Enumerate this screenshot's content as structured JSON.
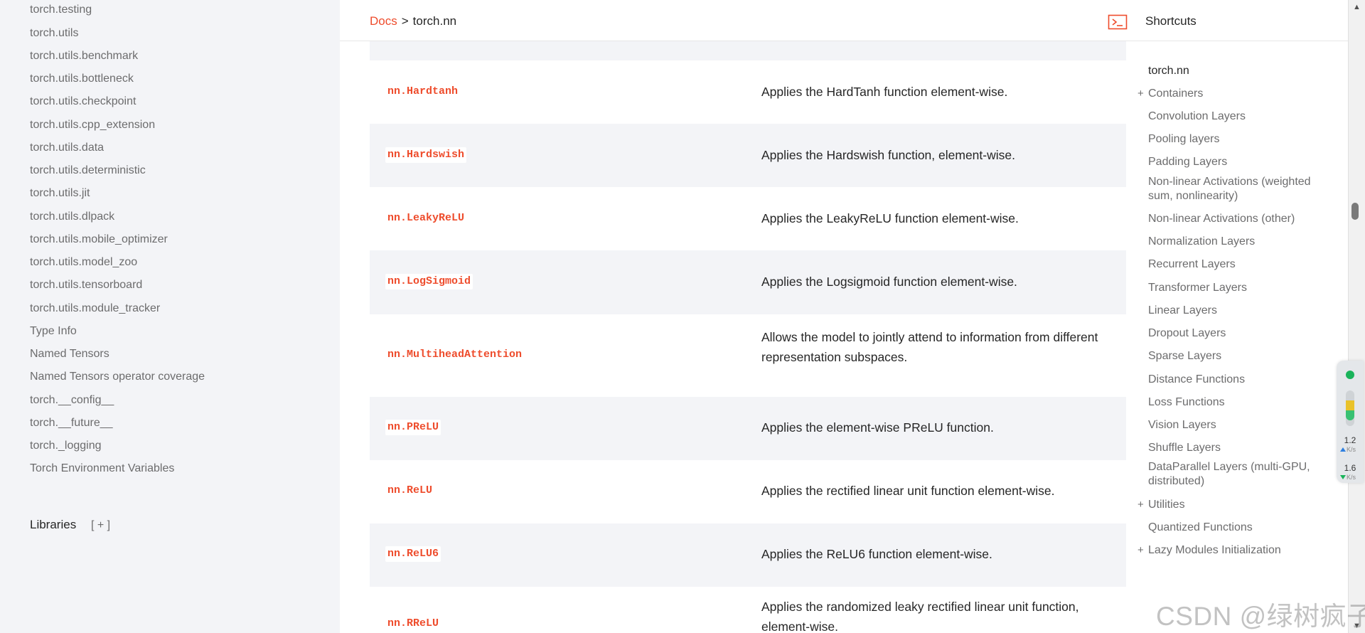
{
  "sidebar": {
    "items": [
      {
        "label": "torch.testing"
      },
      {
        "label": "torch.utils"
      },
      {
        "label": "torch.utils.benchmark"
      },
      {
        "label": "torch.utils.bottleneck"
      },
      {
        "label": "torch.utils.checkpoint"
      },
      {
        "label": "torch.utils.cpp_extension"
      },
      {
        "label": "torch.utils.data"
      },
      {
        "label": "torch.utils.deterministic"
      },
      {
        "label": "torch.utils.jit"
      },
      {
        "label": "torch.utils.dlpack"
      },
      {
        "label": "torch.utils.mobile_optimizer"
      },
      {
        "label": "torch.utils.model_zoo"
      },
      {
        "label": "torch.utils.tensorboard"
      },
      {
        "label": "torch.utils.module_tracker"
      },
      {
        "label": "Type Info"
      },
      {
        "label": "Named Tensors"
      },
      {
        "label": "Named Tensors operator coverage"
      },
      {
        "label": "torch.__config__"
      },
      {
        "label": "torch.__future__"
      },
      {
        "label": "torch._logging"
      },
      {
        "label": "Torch Environment Variables"
      }
    ],
    "libraries": {
      "label": "Libraries",
      "toggle": "[ + ]"
    }
  },
  "header": {
    "breadcrumb": {
      "root": "Docs",
      "separator": ">",
      "current": "torch.nn"
    },
    "terminal_icon": "terminal-icon",
    "shortcuts_title": "Shortcuts"
  },
  "table": {
    "rows": [
      {
        "name": "",
        "desc": ""
      },
      {
        "name": "nn.Hardtanh",
        "desc": "Applies the HardTanh function element-wise."
      },
      {
        "name": "nn.Hardswish",
        "desc": "Applies the Hardswish function, element-wise."
      },
      {
        "name": "nn.LeakyReLU",
        "desc": "Applies the LeakyReLU function element-wise."
      },
      {
        "name": "nn.LogSigmoid",
        "desc": "Applies the Logsigmoid function element-wise."
      },
      {
        "name": "nn.MultiheadAttention",
        "desc": "Allows the model to jointly attend to information from different representation subspaces."
      },
      {
        "name": "nn.PReLU",
        "desc": "Applies the element-wise PReLU function."
      },
      {
        "name": "nn.ReLU",
        "desc": "Applies the rectified linear unit function element-wise."
      },
      {
        "name": "nn.ReLU6",
        "desc": "Applies the ReLU6 function element-wise."
      },
      {
        "name": "nn.RReLU",
        "desc": "Applies the randomized leaky rectified linear unit function, element-wise."
      }
    ]
  },
  "toc": {
    "items": [
      {
        "label": "torch.nn",
        "plus": ""
      },
      {
        "label": "Containers",
        "plus": "+"
      },
      {
        "label": "Convolution Layers",
        "plus": ""
      },
      {
        "label": "Pooling layers",
        "plus": ""
      },
      {
        "label": "Padding Layers",
        "plus": ""
      },
      {
        "label": "Non-linear Activations (weighted sum, nonlinearity)",
        "plus": ""
      },
      {
        "label": "Non-linear Activations (other)",
        "plus": ""
      },
      {
        "label": "Normalization Layers",
        "plus": ""
      },
      {
        "label": "Recurrent Layers",
        "plus": ""
      },
      {
        "label": "Transformer Layers",
        "plus": ""
      },
      {
        "label": "Linear Layers",
        "plus": ""
      },
      {
        "label": "Dropout Layers",
        "plus": ""
      },
      {
        "label": "Sparse Layers",
        "plus": ""
      },
      {
        "label": "Distance Functions",
        "plus": ""
      },
      {
        "label": "Loss Functions",
        "plus": ""
      },
      {
        "label": "Vision Layers",
        "plus": ""
      },
      {
        "label": "Shuffle Layers",
        "plus": ""
      },
      {
        "label": "DataParallel Layers (multi-GPU, distributed)",
        "plus": ""
      },
      {
        "label": "Utilities",
        "plus": "+"
      },
      {
        "label": "Quantized Functions",
        "plus": ""
      },
      {
        "label": "Lazy Modules Initialization",
        "plus": "+"
      }
    ]
  },
  "net_widget": {
    "upload_value": "1.2",
    "upload_unit": "K/s",
    "download_value": "1.6",
    "download_unit": "K/s"
  },
  "scrollbar": {
    "up_icon": "▲",
    "down_icon": "▼"
  },
  "watermark": "CSDN @绿树疯子",
  "colors": {
    "accent": "#ee4c2c",
    "sidebar_bg": "#f3f4f7",
    "row_alt_bg": "#f3f4f7"
  }
}
